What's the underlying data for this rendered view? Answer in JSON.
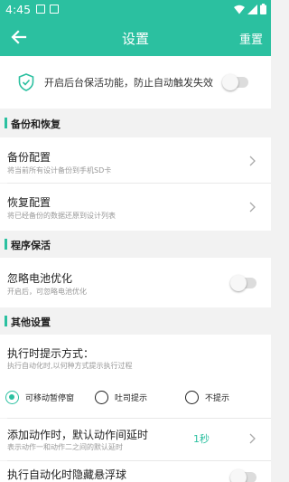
{
  "status_bar": {
    "time": "4:45"
  },
  "app_bar": {
    "title": "设置",
    "reset_label": "重置"
  },
  "keep_alive": {
    "text": "开启后台保活功能，防止自动触发失效",
    "enabled": false
  },
  "sections": {
    "backup": {
      "title": "备份和恢复"
    },
    "protect": {
      "title": "程序保活"
    },
    "other": {
      "title": "其他设置"
    }
  },
  "backup_config": {
    "title": "备份配置",
    "subtitle": "将当前所有设计备份到手机SD卡"
  },
  "restore_config": {
    "title": "恢复配置",
    "subtitle": "将已经备份的数据还原到设计列表"
  },
  "ignore_battery": {
    "title": "忽略电池优化",
    "subtitle": "开启后，可忽略电池优化",
    "enabled": false
  },
  "prompt_mode": {
    "title": "执行时提示方式：",
    "subtitle": "执行自动化时,以何种方式提示执行过程",
    "options": [
      "可移动暂停窗",
      "吐司提示",
      "不提示"
    ],
    "selected": "可移动暂停窗"
  },
  "action_delay": {
    "title": "添加动作时，默认动作间延时",
    "subtitle": "表示动作一和动作二之间的默认延时",
    "value": "1秒"
  },
  "hide_float": {
    "title": "执行自动化时隐藏悬浮球",
    "enabled": false
  },
  "colors": {
    "accent": "#2bc0a0",
    "background": "#f2f2f2"
  }
}
